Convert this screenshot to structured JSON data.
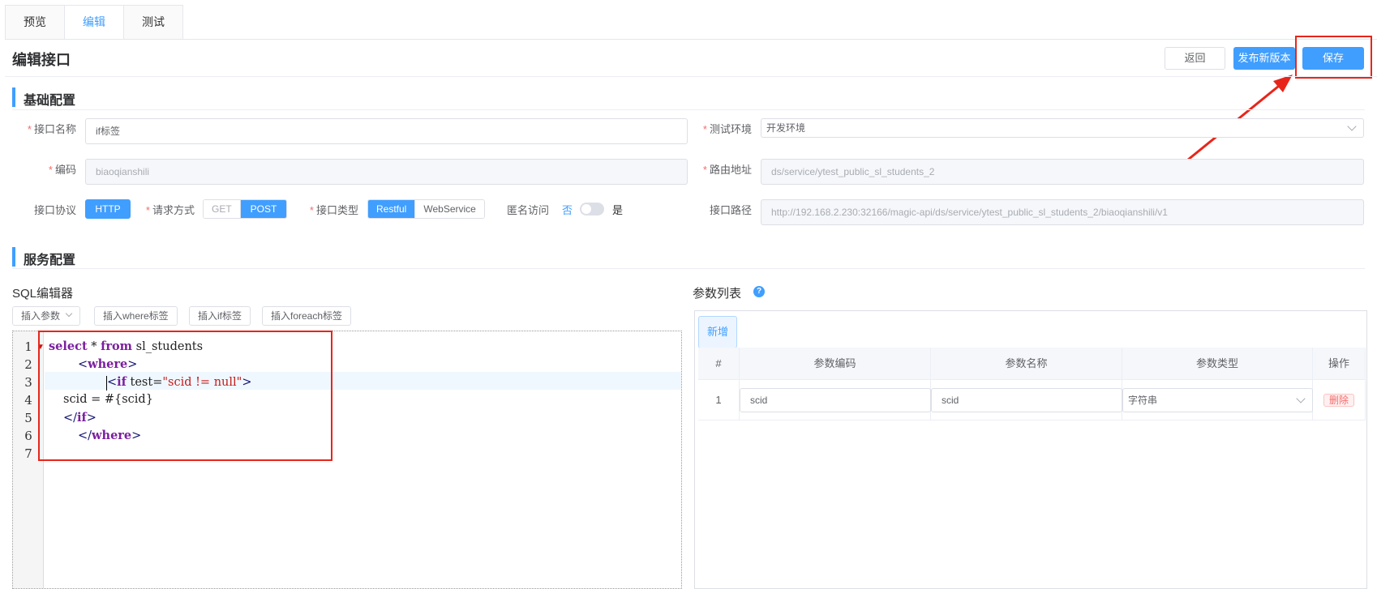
{
  "tabs": [
    {
      "label": "预览"
    },
    {
      "label": "编辑"
    },
    {
      "label": "测试"
    }
  ],
  "header": {
    "title": "编辑接口",
    "back_label": "返回",
    "publish_label": "发布新版本",
    "save_label": "保存"
  },
  "basic": {
    "section_title": "基础配置",
    "name_label": "接口名称",
    "name_value": "if标签",
    "env_label": "测试环境",
    "env_value": "开发环境",
    "code_label": "编码",
    "code_value": "biaoqianshili",
    "route_label": "路由地址",
    "route_value": "ds/service/ytest_public_sl_students_2",
    "protocol_label": "接口协议",
    "protocol_value": "HTTP",
    "method_label": "请求方式",
    "method_options": [
      "GET",
      "POST"
    ],
    "type_label": "接口类型",
    "type_options": [
      "Restful",
      "WebService"
    ],
    "anon_label": "匿名访问",
    "anon_no": "否",
    "anon_yes": "是",
    "path_label": "接口路径",
    "path_value": "http://192.168.2.230:32166/magic-api/ds/service/ytest_public_sl_students_2/biaoqianshili/v1"
  },
  "service": {
    "section_title": "服务配置",
    "sql_title": "SQL编辑器",
    "insert_param": "插入参数",
    "insert_where": "插入where标签",
    "insert_if": "插入if标签",
    "insert_foreach": "插入foreach标签",
    "line_numbers": [
      "1",
      "2",
      "3",
      "4",
      "5",
      "6",
      "7"
    ]
  },
  "params": {
    "title": "参数列表",
    "help": "?",
    "add_label": "新增",
    "columns": [
      "#",
      "参数编码",
      "参数名称",
      "参数类型",
      "操作"
    ],
    "rows": [
      {
        "index": "1",
        "code": "scid",
        "name": "scid",
        "type": "字符串",
        "action": "删除"
      }
    ]
  },
  "colors": {
    "primary": "#409eff",
    "highlight": "#e8251a"
  }
}
